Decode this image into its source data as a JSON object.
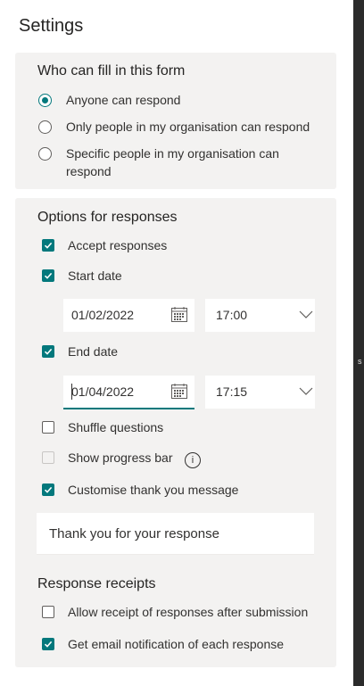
{
  "title": "Settings",
  "who": {
    "heading": "Who can fill in this form",
    "options": [
      {
        "label": "Anyone can respond",
        "selected": true
      },
      {
        "label": "Only people in my organisation can respond",
        "selected": false
      },
      {
        "label": "Specific people in my organisation can",
        "label2": "respond",
        "selected": false
      }
    ]
  },
  "options": {
    "heading": "Options for responses",
    "accept_responses": {
      "label": "Accept responses",
      "checked": true
    },
    "start_date": {
      "label": "Start date",
      "checked": true,
      "date": "01/02/2022",
      "time": "17:00"
    },
    "end_date": {
      "label": "End date",
      "checked": true,
      "date": "01/04/2022",
      "time": "17:15"
    },
    "shuffle": {
      "label": "Shuffle questions",
      "checked": false
    },
    "progress": {
      "label": "Show progress bar",
      "checked": false,
      "disabled": true,
      "info": "i"
    },
    "thankyou": {
      "label": "Customise thank you message",
      "checked": true,
      "message": "Thank you for your response"
    }
  },
  "receipts": {
    "heading": "Response receipts",
    "allow_receipt": {
      "label": "Allow receipt of responses after submission",
      "checked": false
    },
    "email_notify": {
      "label": "Get email notification of each response",
      "checked": true
    }
  },
  "edge_text": "s",
  "colors": {
    "accent": "#03787c",
    "card": "#f3f2f1"
  },
  "icons": [
    "calendar-icon",
    "chevron-down-icon",
    "info-icon",
    "check-icon"
  ]
}
